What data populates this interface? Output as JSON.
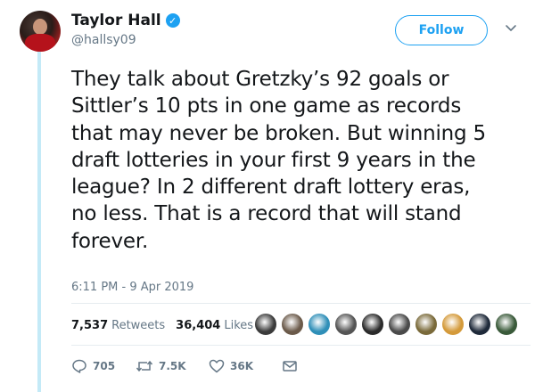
{
  "user": {
    "display_name": "Taylor Hall",
    "handle": "@hallsy09",
    "verified_mark": "✓"
  },
  "follow_button": {
    "label": "Follow"
  },
  "menu": {
    "icon": "chevron-down-icon"
  },
  "tweet": {
    "lines": [
      "They talk about Gretzky’s 92 goals or",
      "Sittler’s 10 pts in one game as records",
      "that may never be broken. But winning 5",
      "draft lotteries in your first 9 years in the",
      "league? In 2 different draft lottery eras,",
      "no less. That is a record that will stand",
      "forever."
    ],
    "timestamp": "6:11 PM - 9 Apr 2019"
  },
  "stats": {
    "retweets_count": "7,537",
    "retweets_label": "Retweets",
    "likes_count": "36,404",
    "likes_label": "Likes"
  },
  "likers": [
    {
      "name": "liker-1",
      "color": "#3b3b3b"
    },
    {
      "name": "liker-2",
      "color": "#6b5a4a"
    },
    {
      "name": "liker-3",
      "color": "#2f8fb8"
    },
    {
      "name": "liker-4",
      "color": "#555555"
    },
    {
      "name": "liker-5",
      "color": "#2b2b2b"
    },
    {
      "name": "liker-6",
      "color": "#4a4a4a"
    },
    {
      "name": "liker-7",
      "color": "#7a6a3a"
    },
    {
      "name": "liker-8",
      "color": "#d49a3a"
    },
    {
      "name": "liker-9",
      "color": "#1f2a3a"
    },
    {
      "name": "liker-10",
      "color": "#3a5a3a"
    }
  ],
  "actions": {
    "reply_count": "705",
    "retweet_count": "7.5K",
    "like_count": "36K"
  },
  "colors": {
    "accent": "#1da1f2",
    "secondary_text": "#657786",
    "thread_line": "#c4eaf7"
  }
}
